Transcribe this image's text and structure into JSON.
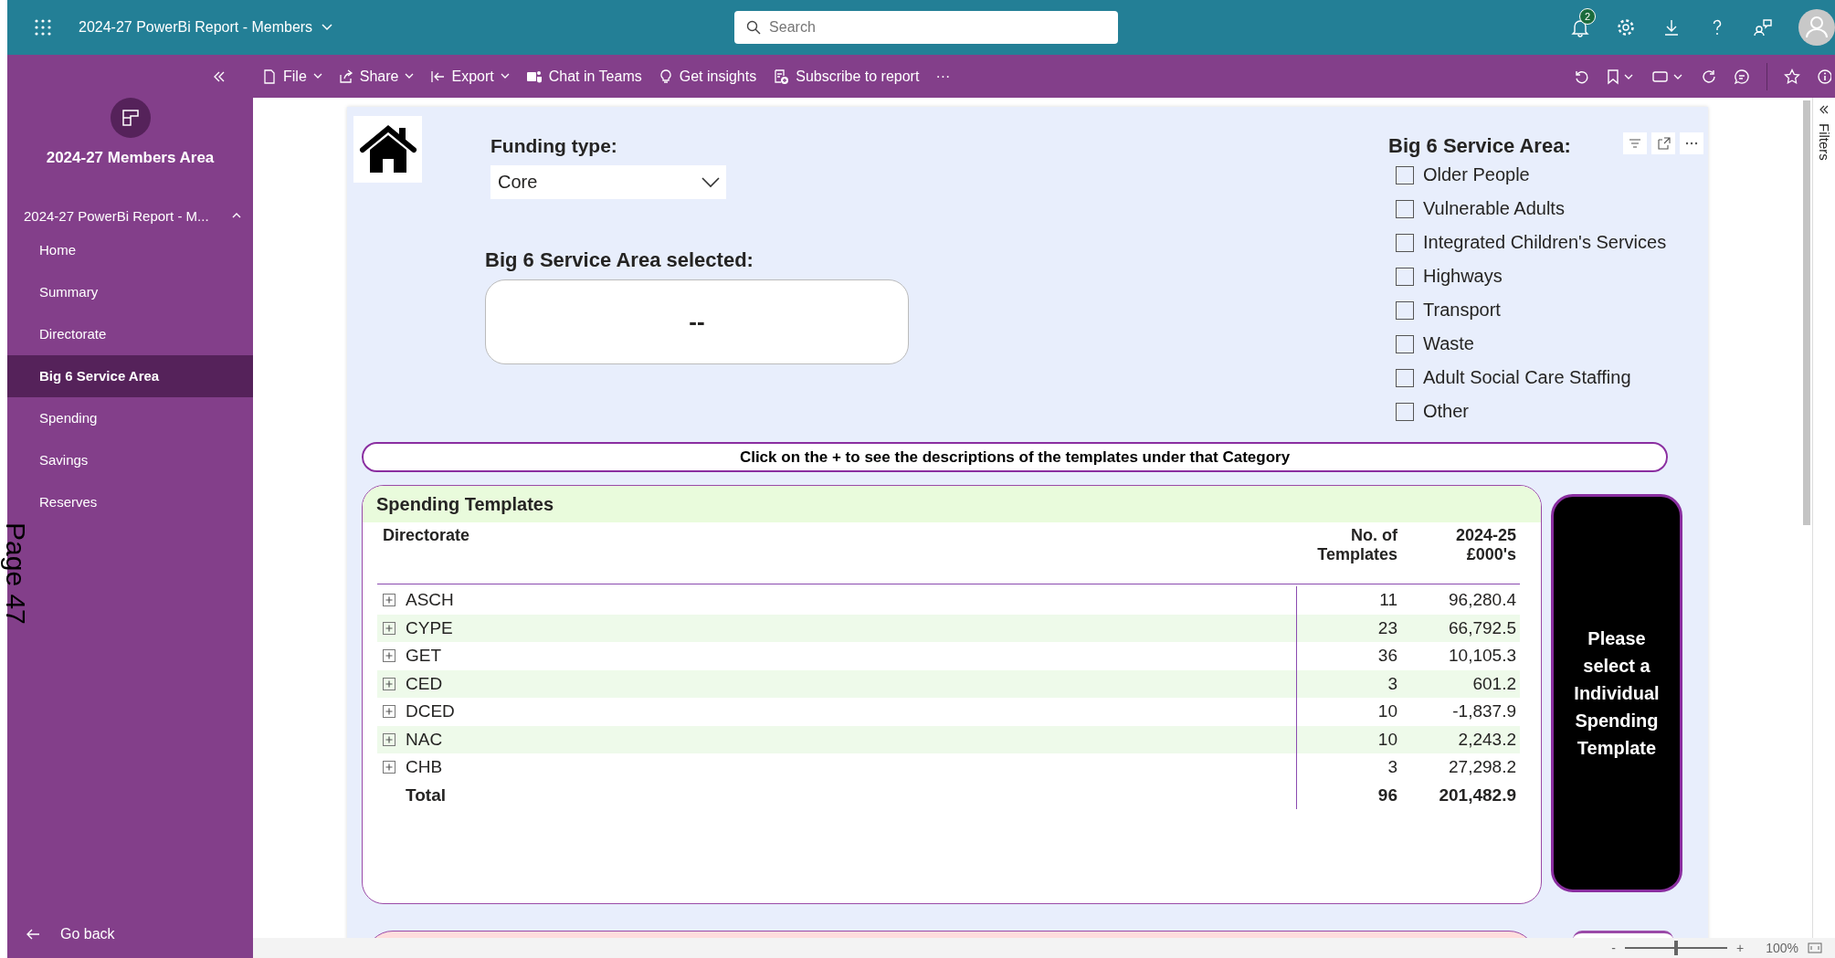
{
  "app": {
    "title": "2024-27 PowerBi Report - Members",
    "search_placeholder": "Search",
    "notification_count": "2"
  },
  "commands": [
    {
      "label": "File",
      "dropdown": true,
      "kind": "file"
    },
    {
      "label": "Share",
      "dropdown": true,
      "kind": "share"
    },
    {
      "label": "Export",
      "dropdown": true,
      "kind": "export"
    },
    {
      "label": "Chat in Teams",
      "dropdown": false,
      "kind": "teams"
    },
    {
      "label": "Get insights",
      "dropdown": false,
      "kind": "insights"
    },
    {
      "label": "Subscribe to report",
      "dropdown": false,
      "kind": "subscribe"
    },
    {
      "label": "···",
      "dropdown": false,
      "kind": "more"
    }
  ],
  "sidebar": {
    "workspace": "2024-27 Members Area",
    "report": "2024-27 PowerBi Report - M...",
    "expanded": true,
    "items": [
      {
        "label": "Home",
        "selected": false
      },
      {
        "label": "Summary",
        "selected": false
      },
      {
        "label": "Directorate",
        "selected": false
      },
      {
        "label": "Big 6 Service Area",
        "selected": true
      },
      {
        "label": "Spending",
        "selected": false
      },
      {
        "label": "Savings",
        "selected": false
      },
      {
        "label": "Reserves",
        "selected": false
      }
    ],
    "back": "Go back"
  },
  "page_label": "Page 47",
  "report": {
    "funding": {
      "label": "Funding type:",
      "value": "Core"
    },
    "selected_card": {
      "label": "Big 6 Service Area selected:",
      "value": "--"
    },
    "slicer": {
      "title": "Big 6 Service Area:",
      "options": [
        {
          "label": "Older People",
          "checked": false
        },
        {
          "label": "Vulnerable Adults",
          "checked": false
        },
        {
          "label": "Integrated Children's Services",
          "checked": false
        },
        {
          "label": "Highways",
          "checked": false
        },
        {
          "label": "Transport",
          "checked": false
        },
        {
          "label": "Waste",
          "checked": false
        },
        {
          "label": "Adult Social Care Staffing",
          "checked": false
        },
        {
          "label": "Other",
          "checked": false
        }
      ]
    },
    "instruction": "Click on the + to see the descriptions of the templates under that Category",
    "table": {
      "title": "Spending Templates",
      "columns": [
        "Directorate",
        "No. of Templates",
        "2024-25 £000's"
      ],
      "rows": [
        {
          "name": "ASCH",
          "count": "11",
          "amount": "96,280.4",
          "expanded": false
        },
        {
          "name": "CYPE",
          "count": "23",
          "amount": "66,792.5",
          "expanded": false
        },
        {
          "name": "GET",
          "count": "36",
          "amount": "10,105.3",
          "expanded": false
        },
        {
          "name": "CED",
          "count": "3",
          "amount": "601.2",
          "expanded": false
        },
        {
          "name": "DCED",
          "count": "10",
          "amount": "-1,837.9",
          "expanded": false
        },
        {
          "name": "NAC",
          "count": "10",
          "amount": "2,243.2",
          "expanded": false
        },
        {
          "name": "CHB",
          "count": "3",
          "amount": "27,298.2",
          "expanded": false
        }
      ],
      "total": {
        "label": "Total",
        "count": "96",
        "amount": "201,482.9"
      }
    },
    "prompt": "Please select a Individual Spending Template"
  },
  "filters_label": "Filters",
  "zoom": {
    "out": "-",
    "in": "+",
    "level": 0.5,
    "reading": "100%"
  }
}
